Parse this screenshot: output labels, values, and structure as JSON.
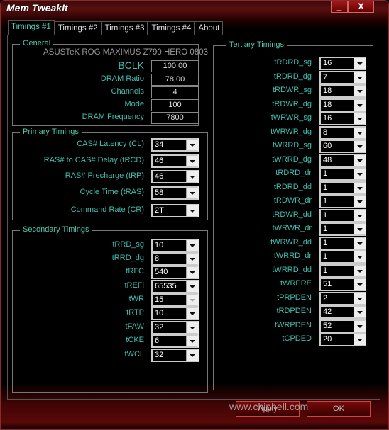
{
  "window": {
    "title": "Mem TweakIt",
    "minimize": "_",
    "close": "X"
  },
  "tabs": [
    "Timings #1",
    "Timings #2",
    "Timings #3",
    "Timings #4",
    "About"
  ],
  "general": {
    "title": "General",
    "board": "ASUSTeK ROG MAXIMUS Z790 HERO 0803",
    "fields": [
      {
        "label": "BCLK",
        "value": "100.00"
      },
      {
        "label": "DRAM Ratio",
        "value": "78.00"
      },
      {
        "label": "Channels",
        "value": "4"
      },
      {
        "label": "Mode",
        "value": "100"
      },
      {
        "label": "DRAM Frequency",
        "value": "7800"
      }
    ]
  },
  "primary": {
    "title": "Primary Timings",
    "items": [
      {
        "label": "CAS# Latency (CL)",
        "value": "34"
      },
      {
        "label": "RAS# to CAS# Delay (tRCD)",
        "value": "46"
      },
      {
        "label": "RAS# Precharge (tRP)",
        "value": "46"
      },
      {
        "label": "Cycle Time (tRAS)",
        "value": "58"
      },
      {
        "label": "Command Rate (CR)",
        "value": "2T"
      }
    ]
  },
  "secondary": {
    "title": "Secondary Timings",
    "items": [
      {
        "label": "tRRD_sg",
        "value": "10"
      },
      {
        "label": "tRRD_dg",
        "value": "8"
      },
      {
        "label": "tRFC",
        "value": "540"
      },
      {
        "label": "tREFi",
        "value": "65535"
      },
      {
        "label": "tWR",
        "value": "15",
        "disabled": true
      },
      {
        "label": "tRTP",
        "value": "10"
      },
      {
        "label": "tFAW",
        "value": "32"
      },
      {
        "label": "tCKE",
        "value": "6"
      },
      {
        "label": "tWCL",
        "value": "32"
      }
    ]
  },
  "tertiary": {
    "title": "Tertiary Timings",
    "items": [
      {
        "label": "tRDRD_sg",
        "value": "16"
      },
      {
        "label": "tRDRD_dg",
        "value": "7"
      },
      {
        "label": "tRDWR_sg",
        "value": "18"
      },
      {
        "label": "tRDWR_dg",
        "value": "18"
      },
      {
        "label": "tWRWR_sg",
        "value": "16"
      },
      {
        "label": "tWRWR_dg",
        "value": "8"
      },
      {
        "label": "tWRRD_sg",
        "value": "60"
      },
      {
        "label": "tWRRD_dg",
        "value": "48"
      },
      {
        "label": "tRDRD_dr",
        "value": "1"
      },
      {
        "label": "tRDRD_dd",
        "value": "1"
      },
      {
        "label": "tRDWR_dr",
        "value": "1"
      },
      {
        "label": "tRDWR_dd",
        "value": "1"
      },
      {
        "label": "tWRWR_dr",
        "value": "1"
      },
      {
        "label": "tWRWR_dd",
        "value": "1"
      },
      {
        "label": "tWRRD_dr",
        "value": "1"
      },
      {
        "label": "tWRRD_dd",
        "value": "1"
      },
      {
        "label": "tWRPRE",
        "value": "51"
      },
      {
        "label": "tPRPDEN",
        "value": "2"
      },
      {
        "label": "tRDPDEN",
        "value": "42"
      },
      {
        "label": "tWRPDEN",
        "value": "52"
      },
      {
        "label": "tCPDED",
        "value": "20"
      }
    ]
  },
  "buttons": {
    "apply": "Apply",
    "ok": "OK"
  },
  "watermark": "www.chiphell.com"
}
